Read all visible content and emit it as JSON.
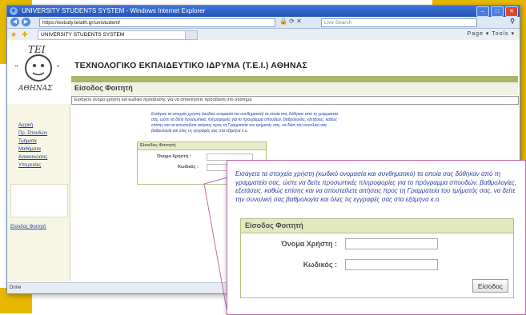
{
  "browser": {
    "window_title": "UNIVERSITY STUDENTS SYSTEM - Windows Internet Explorer",
    "url": "https://estudy.teiath.gr/unistudent/",
    "search_placeholder": "Live Search",
    "tab_title": "UNIVERSITY STUDENTS SYSTEM",
    "tools_text": "Page ▾  Tools ▾",
    "status_text": "Done"
  },
  "page": {
    "logo_text": "ΤΕΙ ΑΘΗΝΑΣ",
    "institution_title": "ΤΕΧΝΟΛΟΓΙΚΟ ΕΚΠΑΙΔΕΥΤΙΚΟ ΙΔΡΥΜΑ (Τ.Ε.Ι.) ΑΘΗΝΑΣ",
    "page_heading": "Είσοδος Φοιτητή",
    "info_line": "Εισάγετε όνομα χρήστη και κωδικό πρόσβασης για να αποκτήσετε πρόσβαση στο σύστημα",
    "intro_text": "Εισάγετε τα στοιχεία χρήστη (κωδικό ονομασία και συνθηματικό) τα οποία σας δόθηκαν από τη γραμματεία σας, ώστε να δείτε προσωπικές πληροφορίες για το πρόγραμμα σπουδών, βαθμολογίες, εξετάσεις, καθώς επίσης και να αποστείλετε αιτήσεις προς τη Γραμματεία του τμήματός σας, να δείτε την συνολική σας βαθμολογία και όλες τις εγγραφές σας στα εξάμηνα κ.ο."
  },
  "sidebar": {
    "items": [
      "Αρχική",
      "Πρ. Σπουδών",
      "Τμήματα",
      "Μαθήματα",
      "Ανακοινώσεις",
      "Υπηρεσίες"
    ],
    "login_link": "Είσοδος Φοιτητή"
  },
  "login_form": {
    "header": "Είσοδος Φοιτητή",
    "username_label": "Όνομα Χρήστη :",
    "password_label": "Κωδικός :",
    "username_value": "",
    "password_value": "",
    "submit_label": "Είσοδος"
  },
  "zoom": {
    "intro_text": "Εισάγετε τα στοιχεία χρήστη (κωδικό ονομασία και συνθηματικό) τα οποία σας δόθηκαν από τη γραμματεία σας, ώστε να δείτε προσωπικές πληροφορίες για το πρόγραμμα σπουδών, βαθμολογίες, εξετάσεις, καθώς επίσης και να αποστείλετε αιτήσεις προς τη Γραμματεία του τμήματός σας, να δείτε την συνολική σας βαθμολογία και όλες τις εγγραφές σας στα εξάμηνα κ.ο.",
    "form_header": "Είσοδος Φοιτητή",
    "username_label": "Όνομα Χρήστη :",
    "password_label": "Κωδικός :",
    "submit_label": "Είσοδος"
  },
  "colors": {
    "frame_gold": "#e6b800",
    "accent_green": "#a5b866",
    "link_blue": "#1b3fa0",
    "callout_magenta": "#c06aa6"
  }
}
